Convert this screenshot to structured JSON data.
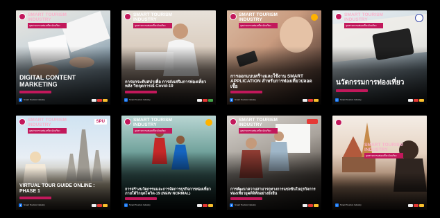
{
  "brand": {
    "line1": "SMART TOURISM",
    "line2": "INDUSTRY",
    "tagline": "อุตสาหกรรมท่องเที่ยวอัจฉริยะ"
  },
  "footer": {
    "page_name": "Smart Tourism Industry"
  },
  "badges": {
    "spu": "SPU"
  },
  "cards": [
    {
      "title": "DIGITAL CONTENT MARKETING"
    },
    {
      "title": "การยกระดับสปาเพื่อ การส่งเสริมการท่องเที่ยวหลัง วิกฤตการณ์ Covid-19"
    },
    {
      "title": "การออกแบบสร้างและใช้งาน SMART APPLICATION สำหรับการท่องเที่ยวปลอดเชื้อ"
    },
    {
      "title": "นวัตกรรมการท่องเที่ยว"
    },
    {
      "title": "VIRTUAL TOUR GUIDE ONLINE : PHASE 1"
    },
    {
      "title": "การสร้างนวัตกรรมและการจัดการธุรกิจการท่องเที่ยวภายใต้วิกฤตโควิด-19 (NEW NORMAL)"
    },
    {
      "title": "การพัฒนาความสามารถทางการแข่งขันในธุรกิจการท่องเที่ยวยุคดิจิทัลอย่างยั่งยืน"
    },
    {
      "title": ""
    }
  ],
  "colors": {
    "accent": "#c2185b",
    "background": "#000000"
  }
}
